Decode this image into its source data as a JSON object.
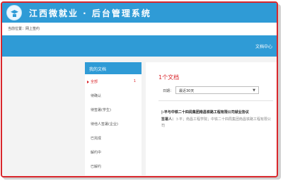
{
  "header": {
    "title": "江西微就业 · 后台管理系统",
    "logo": "graduation-cap-icon"
  },
  "breadcrumb": {
    "prefix": "当前位置：",
    "current": "网上签约"
  },
  "banner": {
    "doc_center_label": "文档中心"
  },
  "sidebar": {
    "heading": "我的文档",
    "items": [
      {
        "label": "全部",
        "count": "1",
        "active": true
      },
      {
        "label": "待确认"
      },
      {
        "label": "待签署(学生)"
      },
      {
        "label": "待他人签署(企业)"
      },
      {
        "label": "已完成"
      },
      {
        "label": "解约中"
      },
      {
        "label": "已解约"
      }
    ]
  },
  "main": {
    "doc_count": "1个文档",
    "date_filter": {
      "label": "日期：",
      "value": "最近30天"
    },
    "document": {
      "title": "|-平与中铁二十四局集团南昌铁路工程有限公司就业协议",
      "signers_label": "签署人：",
      "signers": "卜平；南昌工程学院；中铁二十四局集团南昌铁路工程有限公司"
    }
  },
  "colors": {
    "brand_blue": "#2f9bd6",
    "accent_red": "#d9262b"
  }
}
